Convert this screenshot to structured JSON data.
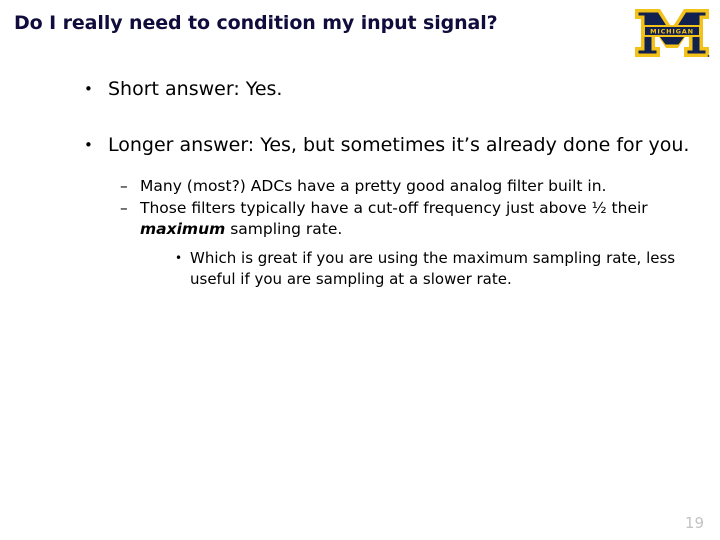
{
  "slide": {
    "title": "Do I really need to condition my input signal?",
    "title_color": "#100d3c",
    "background_color": "#ffffff",
    "page_number": "19"
  },
  "logo": {
    "name": "university-of-michigan-block-m-logo",
    "wordmark": "MICHIGAN",
    "navy": "#12204f",
    "maize": "#f2c21a"
  },
  "bullets": {
    "level1": [
      {
        "marker": "•",
        "text": "Short answer: Yes."
      },
      {
        "marker": "•",
        "text": "Longer answer: Yes, but sometimes it’s already done for you."
      }
    ],
    "level2": [
      {
        "marker": "–",
        "text": "Many (most?) ADCs have a pretty good analog filter built in."
      },
      {
        "marker": "–",
        "text_before": "Those filters typically have a cut-off frequency just above ½ their ",
        "emphasis": "maximum",
        "text_after": " sampling rate."
      }
    ],
    "level3": [
      {
        "marker": "•",
        "text": "Which is great if you are using the maximum sampling rate, less useful if you are sampling at a slower rate."
      }
    ]
  }
}
